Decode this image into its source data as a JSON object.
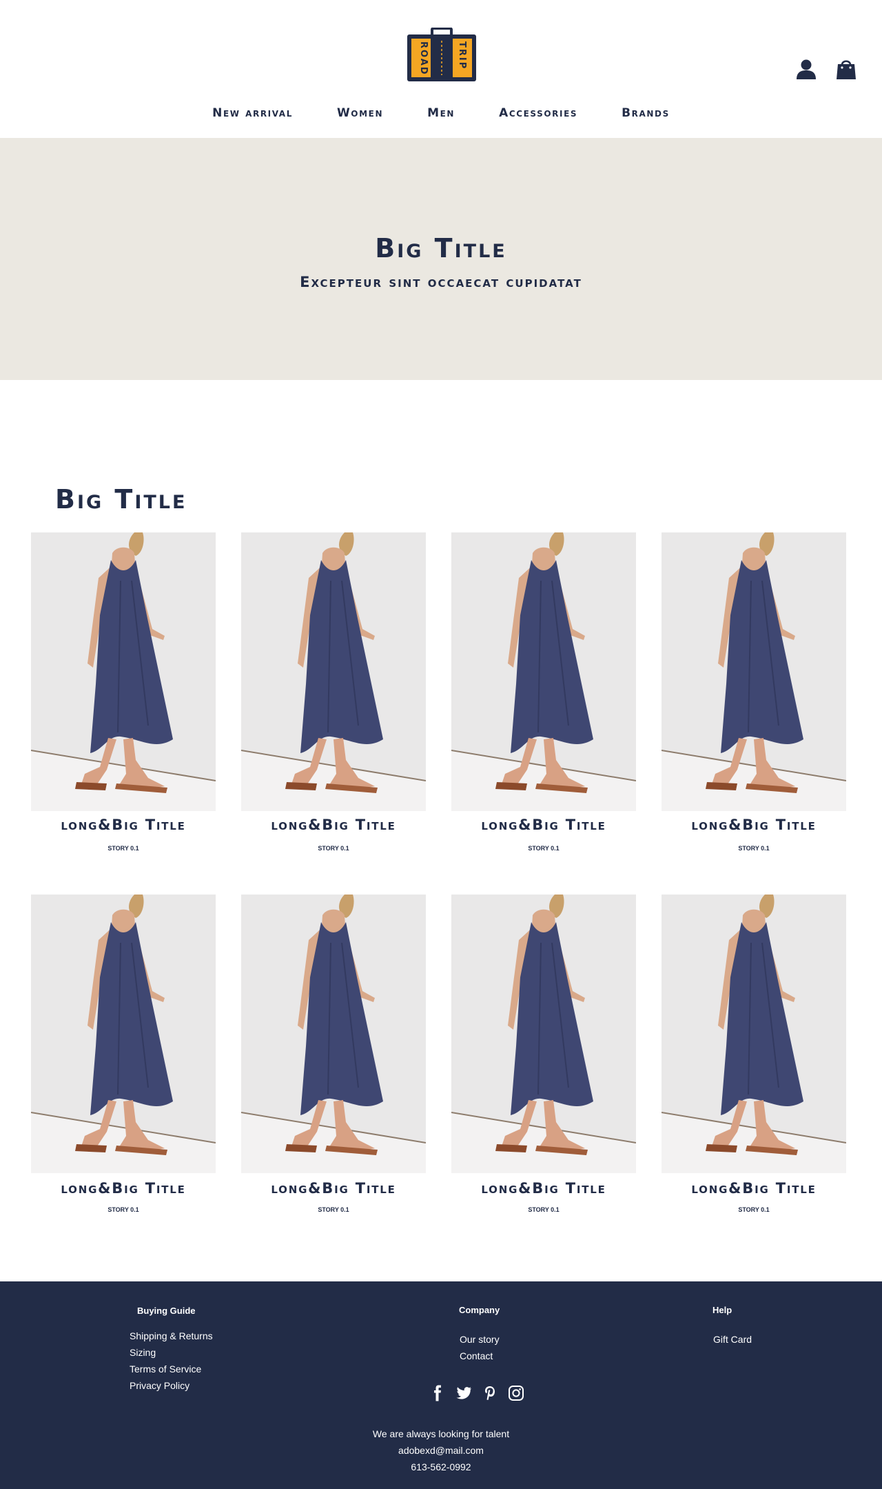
{
  "colors": {
    "navy": "#222c47",
    "hero_bg": "#ebe8e1",
    "logo_yellow": "#f5a623",
    "footer_bg": "#222c47"
  },
  "logo": {
    "left_word": "ROAD",
    "right_word": "TRIP"
  },
  "header": {
    "icons": [
      "user-icon",
      "shopping-bag-icon"
    ]
  },
  "nav": {
    "items": [
      {
        "label": "New arrival"
      },
      {
        "label": "Women"
      },
      {
        "label": "Men"
      },
      {
        "label": "Accessories"
      },
      {
        "label": "Brands"
      }
    ]
  },
  "hero": {
    "title": "Big Title",
    "subtitle": "Excepteur sint occaecat cupidatat"
  },
  "products": {
    "section_title": "Big Title",
    "items": [
      {
        "name": "long&Big Title",
        "story": "STORY 0.1"
      },
      {
        "name": "long&Big Title",
        "story": "STORY 0.1"
      },
      {
        "name": "long&Big Title",
        "story": "STORY 0.1"
      },
      {
        "name": "long&Big Title",
        "story": "STORY 0.1"
      },
      {
        "name": "long&Big Title",
        "story": "STORY 0.1"
      },
      {
        "name": "long&Big Title",
        "story": "STORY 0.1"
      },
      {
        "name": "long&Big Title",
        "story": "STORY 0.1"
      },
      {
        "name": "long&Big Title",
        "story": "STORY 0.1"
      }
    ]
  },
  "footer": {
    "buying_guide": {
      "title": "Buying Guide",
      "links": [
        "Shipping & Returns",
        "Sizing",
        "Terms of Service",
        "Privacy Policy"
      ]
    },
    "company": {
      "title": "Company",
      "links": [
        "Our story",
        "Contact"
      ]
    },
    "help": {
      "title": "Help",
      "links": [
        "Gift Card"
      ]
    },
    "social_icons": [
      "facebook-icon",
      "twitter-icon",
      "pinterest-icon",
      "instagram-icon"
    ],
    "tagline": "We are always looking for talent",
    "email": "adobexd@mail.com",
    "phone": "613-562-0992"
  }
}
